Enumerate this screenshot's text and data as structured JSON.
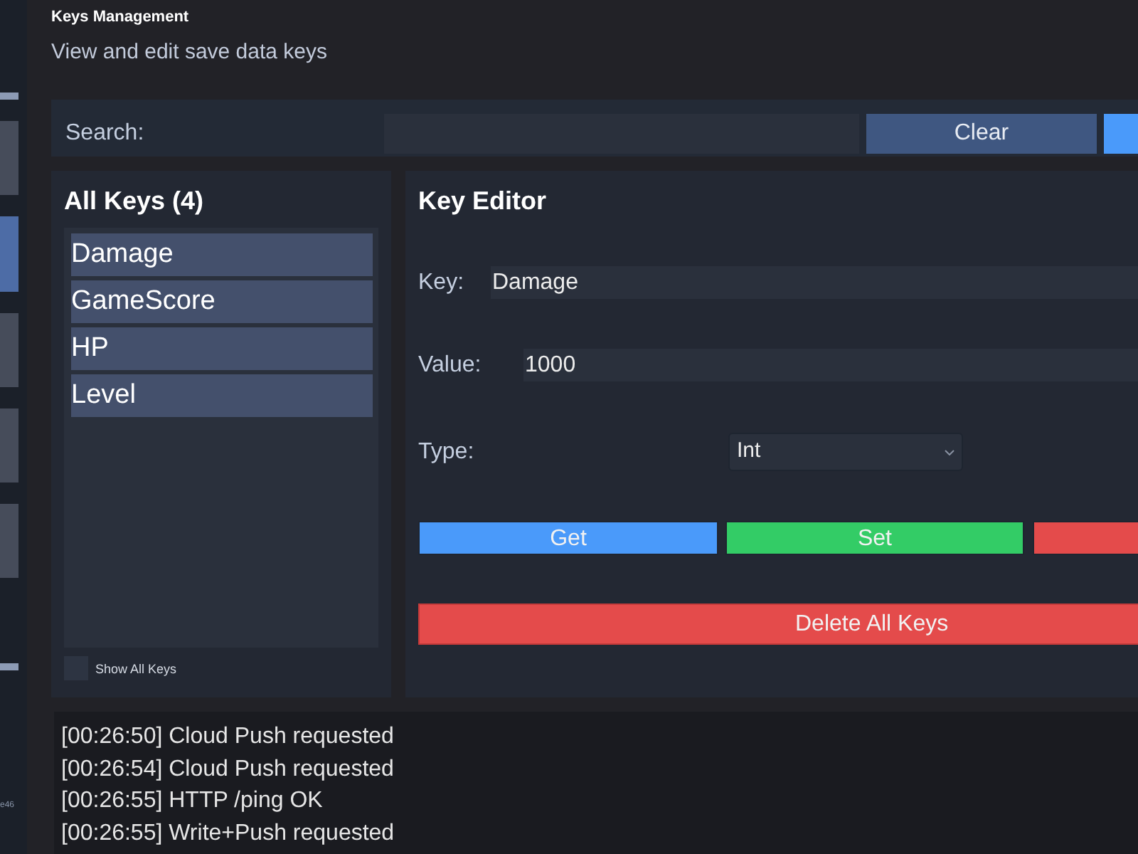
{
  "sidebar": {
    "tabs": [
      {
        "selected": false
      },
      {
        "selected": true
      },
      {
        "selected": false
      },
      {
        "selected": false
      },
      {
        "selected": false
      }
    ],
    "footer_text": "e46"
  },
  "header": {
    "title": "Keys Management",
    "subtitle": "View and edit save data keys"
  },
  "search": {
    "label": "Search:",
    "buttons": [
      {
        "label": "Clear",
        "color": "#3f5781"
      },
      {
        "color": "#4a9afa"
      }
    ]
  },
  "keys_panel": {
    "title": "All Keys (4)",
    "items": [
      {
        "label": "Damage"
      },
      {
        "label": "GameScore"
      },
      {
        "label": "HP"
      },
      {
        "label": "Level"
      }
    ],
    "show_all": {
      "label": "Show All Keys",
      "checked": false
    }
  },
  "editor": {
    "title": "Key Editor",
    "fields": [
      {
        "label": "Key:",
        "value": "Damage"
      },
      {
        "label": "Value:",
        "value": "1000"
      }
    ],
    "type": {
      "label": "Type:",
      "value": "Int"
    },
    "actions": [
      {
        "label": "Get",
        "color": "#4a9afa"
      },
      {
        "label": "Set",
        "color": "#33cc66"
      },
      {
        "color": "#e44b4b"
      }
    ],
    "delete_all": {
      "label": "Delete All Keys"
    }
  },
  "log": {
    "lines": [
      "[00:26:50] Cloud Push requested",
      "[00:26:54] Cloud Push requested",
      "[00:26:55] HTTP /ping OK",
      "[00:26:55] Write+Push requested"
    ]
  }
}
